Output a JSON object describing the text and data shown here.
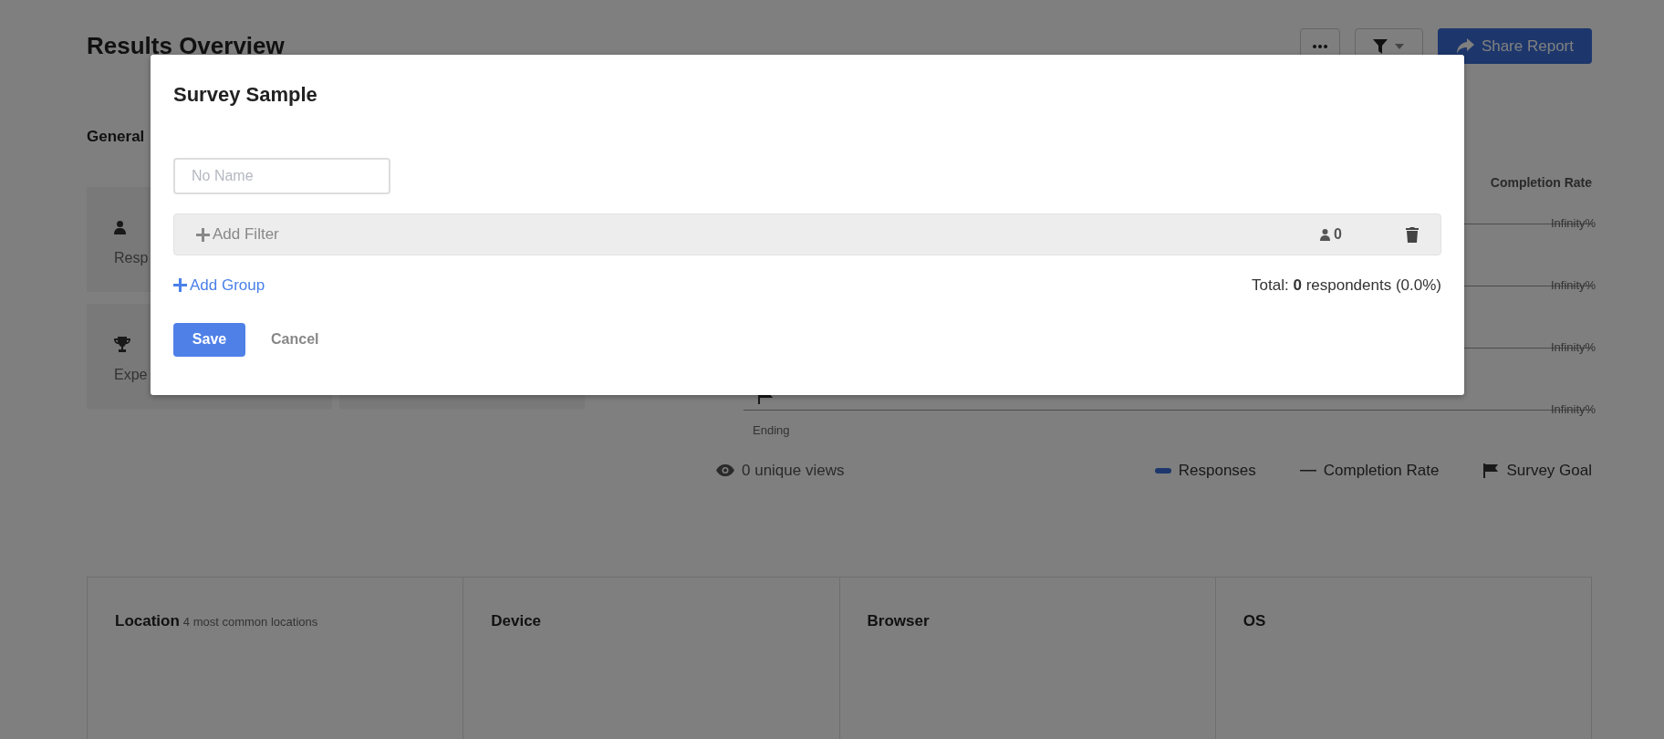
{
  "page": {
    "title": "Results Overview",
    "share_button": "Share Report"
  },
  "general": {
    "title": "General",
    "cards": [
      {
        "kind": "person",
        "label": "Resp"
      },
      {
        "kind": "trophy",
        "label": "Expe"
      }
    ]
  },
  "chart": {
    "header": "Completion Rate",
    "rows": [
      {
        "reading": "Infinity%"
      },
      {
        "reading": "Infinity%"
      },
      {
        "reading": "Infinity%"
      },
      {
        "reading": "Infinity%"
      }
    ],
    "ending_label": "Ending",
    "views": "0 unique views",
    "legend": [
      {
        "kind": "bar",
        "label": "Responses"
      },
      {
        "kind": "line",
        "label": "Completion Rate"
      },
      {
        "kind": "flag",
        "label": "Survey Goal"
      }
    ]
  },
  "panels": [
    {
      "title": "Location",
      "subtitle": "4 most common locations"
    },
    {
      "title": "Device"
    },
    {
      "title": "Browser"
    },
    {
      "title": "OS"
    }
  ],
  "modal": {
    "title": "Survey Sample",
    "name_field": {
      "placeholder": "No Name"
    },
    "filter_row": {
      "add_filter": "Add Filter",
      "count": "0"
    },
    "add_group": "Add Group",
    "total": "Total: **0** respondents (0.0%)",
    "save": "Save",
    "cancel": "Cancel"
  }
}
